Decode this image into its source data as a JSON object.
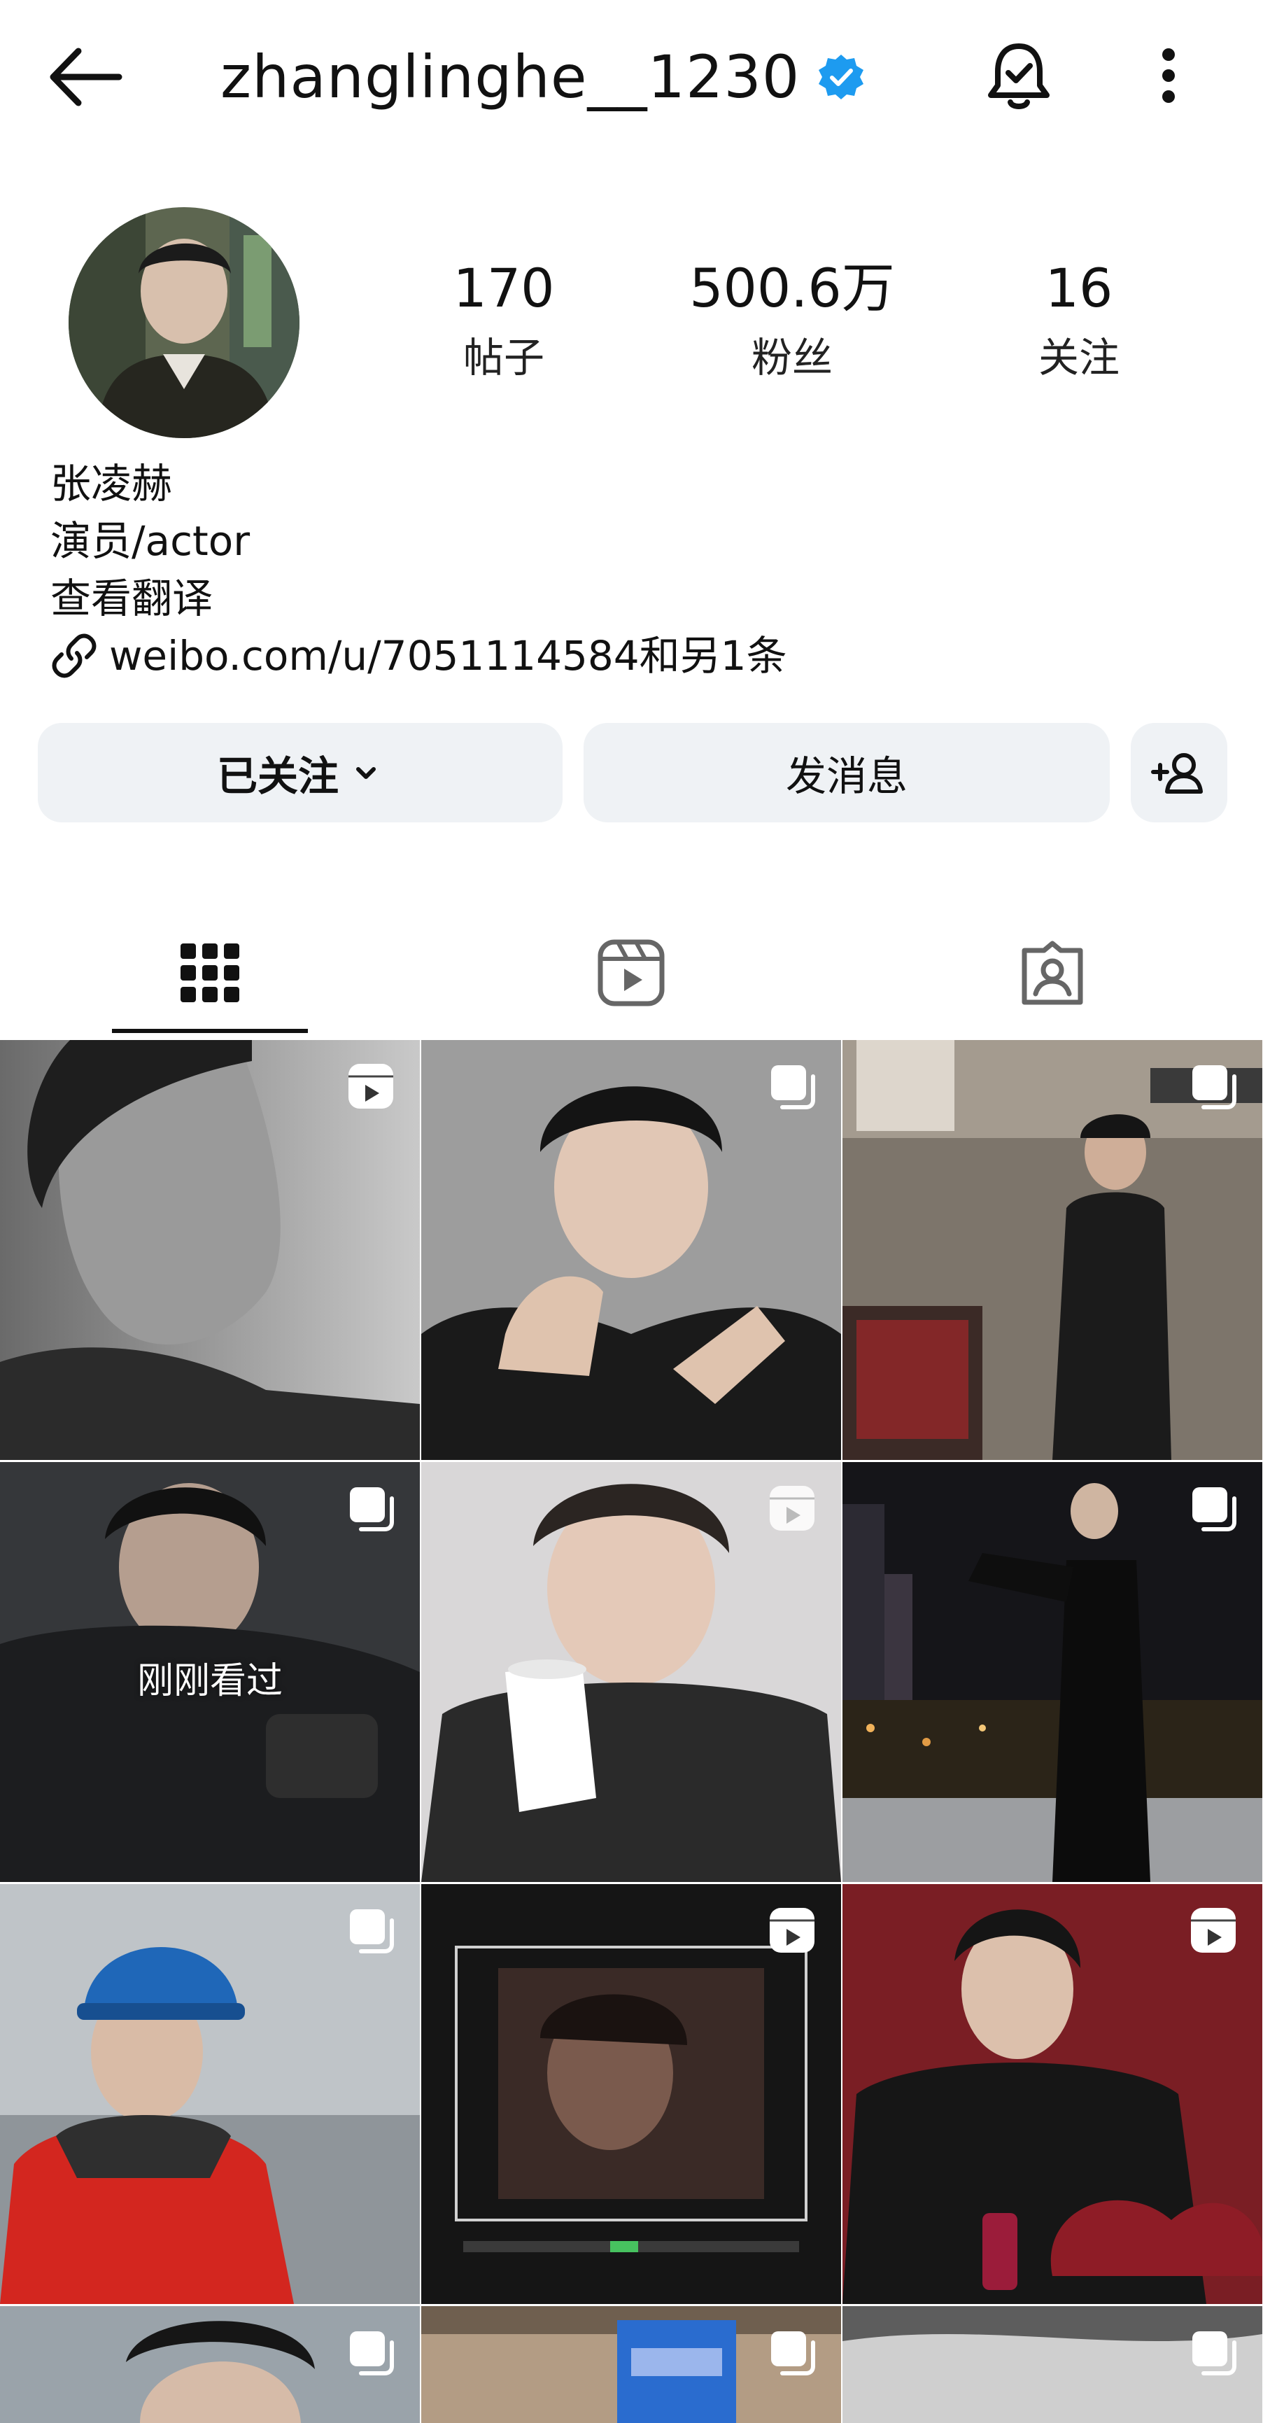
{
  "header": {
    "username": "zhanglinghe__1230",
    "verified_icon": "verified-badge-icon",
    "back_icon": "back-arrow-icon",
    "bell_icon": "notification-bell-icon",
    "more_icon": "more-vertical-icon"
  },
  "profile": {
    "stats": [
      {
        "value": "170",
        "label": "帖子"
      },
      {
        "value": "500.6万",
        "label": "粉丝"
      },
      {
        "value": "16",
        "label": "关注"
      }
    ],
    "name": "张凌赫",
    "bio": "演员/actor",
    "translate": "查看翻译",
    "link": "weibo.com/u/7051114584和另1条"
  },
  "actions": {
    "follow": "已关注",
    "message": "发消息",
    "add_user_icon": "add-user-icon"
  },
  "tabs": [
    {
      "name": "posts",
      "icon": "grid-icon",
      "active": true
    },
    {
      "name": "reels",
      "icon": "reels-icon",
      "active": false
    },
    {
      "name": "tagged",
      "icon": "tagged-icon",
      "active": false
    }
  ],
  "grid": {
    "recently_viewed_caption": "刚刚看过"
  },
  "colors": {
    "verified_blue": "#1d9bf0",
    "button_bg": "#eff2f5",
    "text": "#111111"
  }
}
